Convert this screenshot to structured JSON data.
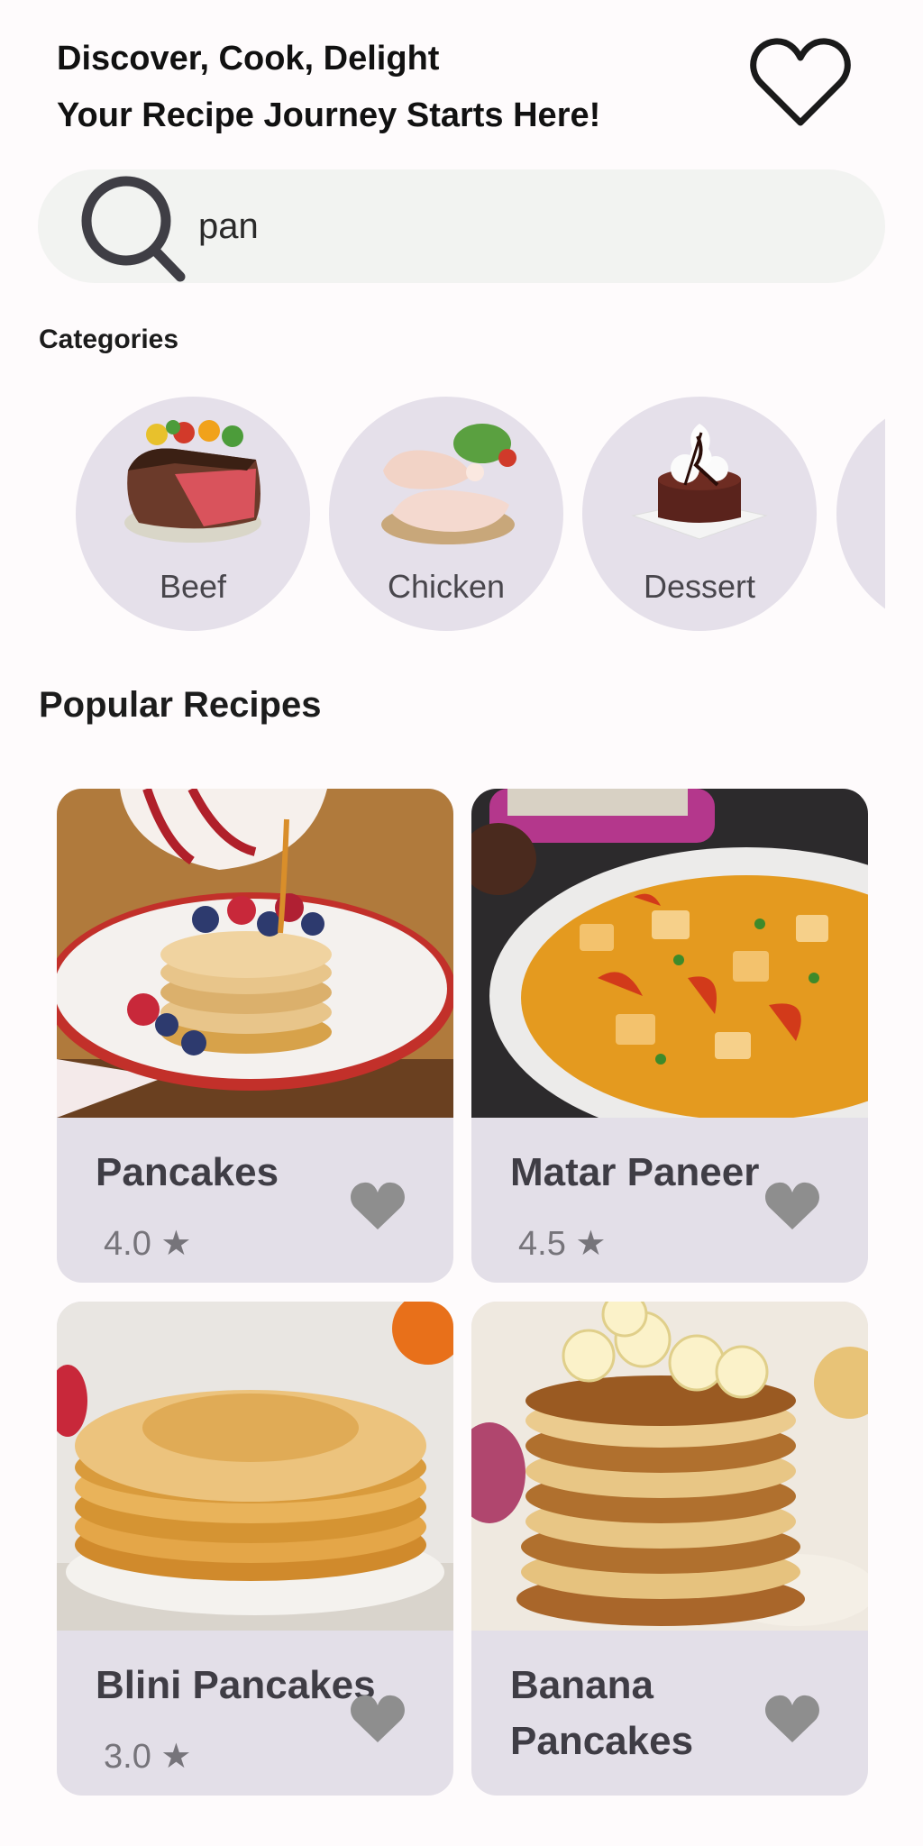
{
  "header": {
    "title_line1": "Discover, Cook, Delight",
    "title_line2": "Your Recipe Journey Starts Here!",
    "favorites_icon": "heart-outline-icon"
  },
  "search": {
    "value": "pan",
    "placeholder": "",
    "icon": "search-icon"
  },
  "categories": {
    "label": "Categories",
    "items": [
      {
        "label": "Beef"
      },
      {
        "label": "Chicken"
      },
      {
        "label": "Dessert"
      },
      {
        "label": ""
      }
    ]
  },
  "popular": {
    "title": "Popular Recipes",
    "recipes": [
      {
        "name": "Pancakes",
        "rating": "4.0 ★"
      },
      {
        "name": "Matar Paneer",
        "rating": "4.5 ★"
      },
      {
        "name": "Blini Pancakes",
        "rating": "3.0 ★"
      },
      {
        "name": "Banana Pancakes",
        "rating": ""
      }
    ]
  },
  "colors": {
    "background": "#fefbfc",
    "search_bg": "#f2f3f1",
    "category_bg": "#e5e0ea",
    "card_bg": "#e3dfe8",
    "heart": "#8e8e8e"
  }
}
